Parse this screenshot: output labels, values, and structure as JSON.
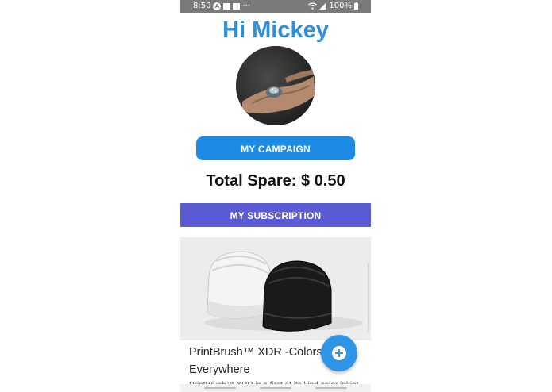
{
  "status_bar": {
    "time": "8:50",
    "overflow": "···",
    "battery": "100%",
    "icons": [
      "a-icon",
      "image-icon",
      "gallery-icon",
      "wifi-icon",
      "signal-icon",
      "battery-icon"
    ]
  },
  "header": {
    "greeting": "Hi Mickey"
  },
  "profile": {
    "avatar_icon": "avatar-photo"
  },
  "buttons": {
    "campaign_label": "MY CAMPAIGN",
    "subscription_label": "MY SUBSCRIPTION"
  },
  "summary": {
    "total_spare": "Total Spare: $ 0.50"
  },
  "card": {
    "title": "PrintBrush™ XDR -Colors. Everywhere",
    "description": "PrintBrush™ XDR is a first of its kind color inkjet"
  },
  "fab": {
    "icon": "plus-icon"
  },
  "colors": {
    "accent_blue": "#2f8fdc",
    "campaign_button": "#1d8be4",
    "subscription_button": "#5b5bd6",
    "status_bar": "#7a7a7a"
  }
}
